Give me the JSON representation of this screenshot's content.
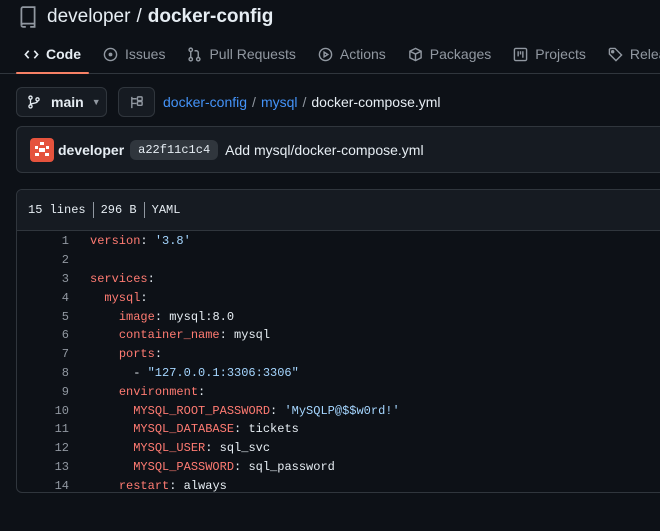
{
  "repo": {
    "owner": "developer",
    "separator": "/",
    "name": "docker-config"
  },
  "tabs": [
    {
      "label": "Code",
      "icon": "code-icon",
      "active": true
    },
    {
      "label": "Issues",
      "icon": "issue-icon",
      "active": false
    },
    {
      "label": "Pull Requests",
      "icon": "pull-request-icon",
      "active": false
    },
    {
      "label": "Actions",
      "icon": "play-icon",
      "active": false
    },
    {
      "label": "Packages",
      "icon": "package-icon",
      "active": false
    },
    {
      "label": "Projects",
      "icon": "project-icon",
      "active": false
    },
    {
      "label": "Releases",
      "icon": "tag-icon",
      "active": false
    }
  ],
  "branch": {
    "label": "main"
  },
  "breadcrumb": {
    "parts": [
      "docker-config",
      "mysql"
    ],
    "file": "docker-compose.yml",
    "separator": "/"
  },
  "commit": {
    "author": "developer",
    "sha": "a22f11c1c4",
    "message": "Add mysql/docker-compose.yml"
  },
  "file_info": {
    "lines": "15 lines",
    "size": "296 B",
    "type": "YAML"
  },
  "code_lines": [
    {
      "n": "1",
      "parts": [
        [
          "k",
          "version"
        ],
        [
          "v",
          ": "
        ],
        [
          "s",
          "'3.8'"
        ]
      ]
    },
    {
      "n": "2",
      "parts": []
    },
    {
      "n": "3",
      "parts": [
        [
          "k",
          "services"
        ],
        [
          "v",
          ":"
        ]
      ]
    },
    {
      "n": "4",
      "parts": [
        [
          "v",
          "  "
        ],
        [
          "k",
          "mysql"
        ],
        [
          "v",
          ":"
        ]
      ]
    },
    {
      "n": "5",
      "parts": [
        [
          "v",
          "    "
        ],
        [
          "k",
          "image"
        ],
        [
          "v",
          ": mysql:8.0"
        ]
      ]
    },
    {
      "n": "6",
      "parts": [
        [
          "v",
          "    "
        ],
        [
          "k",
          "container_name"
        ],
        [
          "v",
          ": mysql"
        ]
      ]
    },
    {
      "n": "7",
      "parts": [
        [
          "v",
          "    "
        ],
        [
          "k",
          "ports"
        ],
        [
          "v",
          ":"
        ]
      ]
    },
    {
      "n": "8",
      "parts": [
        [
          "v",
          "      - "
        ],
        [
          "s",
          "\"127.0.0.1:3306:3306\""
        ]
      ]
    },
    {
      "n": "9",
      "parts": [
        [
          "v",
          "    "
        ],
        [
          "k",
          "environment"
        ],
        [
          "v",
          ":"
        ]
      ]
    },
    {
      "n": "10",
      "parts": [
        [
          "v",
          "      "
        ],
        [
          "k",
          "MYSQL_ROOT_PASSWORD"
        ],
        [
          "v",
          ": "
        ],
        [
          "s",
          "'MySQLP@$$w0rd!'"
        ]
      ]
    },
    {
      "n": "11",
      "parts": [
        [
          "v",
          "      "
        ],
        [
          "k",
          "MYSQL_DATABASE"
        ],
        [
          "v",
          ": tickets"
        ]
      ]
    },
    {
      "n": "12",
      "parts": [
        [
          "v",
          "      "
        ],
        [
          "k",
          "MYSQL_USER"
        ],
        [
          "v",
          ": sql_svc"
        ]
      ]
    },
    {
      "n": "13",
      "parts": [
        [
          "v",
          "      "
        ],
        [
          "k",
          "MYSQL_PASSWORD"
        ],
        [
          "v",
          ": sql_password"
        ]
      ]
    },
    {
      "n": "14",
      "parts": [
        [
          "v",
          "    "
        ],
        [
          "k",
          "restart"
        ],
        [
          "v",
          ": always"
        ]
      ]
    }
  ],
  "colors": {
    "background": "#0d1117",
    "link": "#4493f8",
    "key": "#ff7b72",
    "string": "#a5d6ff",
    "active_tab_underline": "#f78166"
  }
}
